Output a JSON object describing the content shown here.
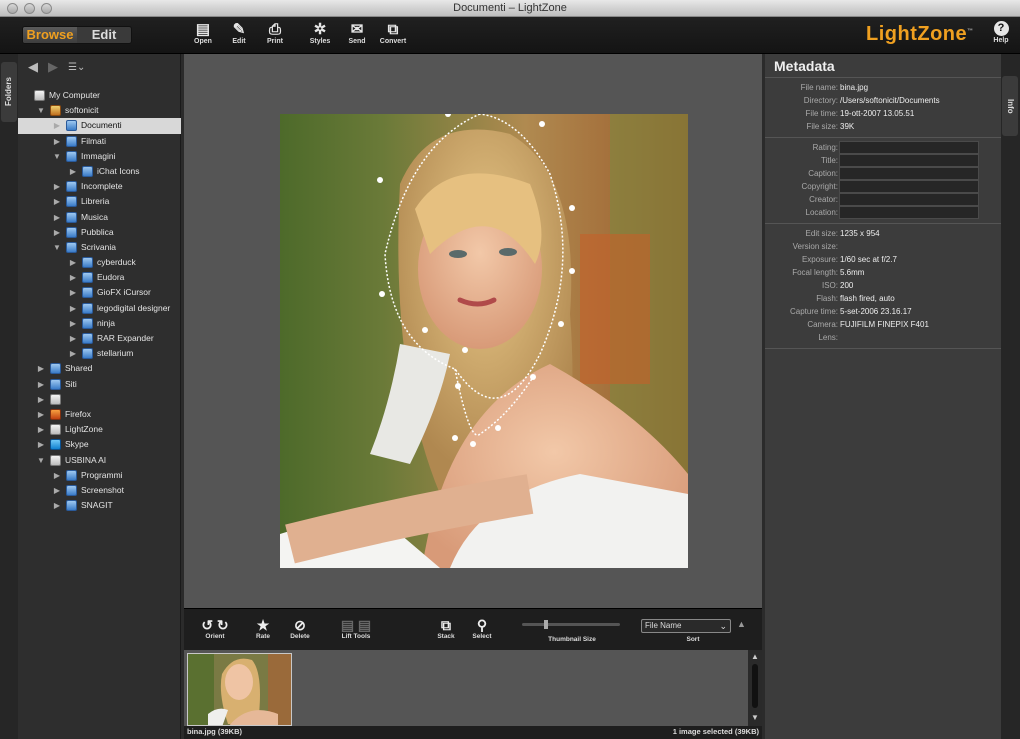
{
  "window": {
    "title": "Documenti – LightZone"
  },
  "modes": {
    "browse": "Browse",
    "edit": "Edit"
  },
  "toolbar": [
    {
      "label": "Open",
      "icon": "open-icon",
      "glyph": "▤"
    },
    {
      "label": "Edit",
      "icon": "edit-icon",
      "glyph": "✎"
    },
    {
      "label": "Print",
      "icon": "print-icon",
      "glyph": "⎙"
    },
    {
      "label": "Styles",
      "icon": "styles-icon",
      "glyph": "✲"
    },
    {
      "label": "Send",
      "icon": "send-icon",
      "glyph": "✉"
    },
    {
      "label": "Convert",
      "icon": "convert-icon",
      "glyph": "⧉"
    }
  ],
  "brand": "LightZone",
  "help": "Help",
  "side_tabs": {
    "left": "Folders",
    "right": "Info"
  },
  "folders": [
    {
      "label": "My Computer",
      "depth": 0,
      "arrow": "",
      "icon": "drive"
    },
    {
      "label": "softonicit",
      "depth": 1,
      "arrow": "▼",
      "icon": "home"
    },
    {
      "label": "Documenti",
      "depth": 2,
      "arrow": "▶",
      "icon": "folder",
      "selected": true
    },
    {
      "label": "Filmati",
      "depth": 2,
      "arrow": "▶",
      "icon": "folder"
    },
    {
      "label": "Immagini",
      "depth": 2,
      "arrow": "▼",
      "icon": "folder"
    },
    {
      "label": "iChat Icons",
      "depth": 3,
      "arrow": "▶",
      "icon": "folder"
    },
    {
      "label": "Incomplete",
      "depth": 2,
      "arrow": "▶",
      "icon": "folder"
    },
    {
      "label": "Libreria",
      "depth": 2,
      "arrow": "▶",
      "icon": "folder"
    },
    {
      "label": "Musica",
      "depth": 2,
      "arrow": "▶",
      "icon": "folder"
    },
    {
      "label": "Pubblica",
      "depth": 2,
      "arrow": "▶",
      "icon": "folder"
    },
    {
      "label": "Scrivania",
      "depth": 2,
      "arrow": "▼",
      "icon": "folder"
    },
    {
      "label": "cyberduck",
      "depth": 3,
      "arrow": "▶",
      "icon": "folder"
    },
    {
      "label": "Eudora",
      "depth": 3,
      "arrow": "▶",
      "icon": "folder"
    },
    {
      "label": "GioFX iCursor",
      "depth": 3,
      "arrow": "▶",
      "icon": "folder"
    },
    {
      "label": "legodigital designer",
      "depth": 3,
      "arrow": "▶",
      "icon": "folder"
    },
    {
      "label": "ninja",
      "depth": 3,
      "arrow": "▶",
      "icon": "folder"
    },
    {
      "label": "RAR Expander",
      "depth": 3,
      "arrow": "▶",
      "icon": "folder"
    },
    {
      "label": "stellarium",
      "depth": 3,
      "arrow": "▶",
      "icon": "folder"
    },
    {
      "label": "Shared",
      "depth": 1,
      "arrow": "▶",
      "icon": "folder"
    },
    {
      "label": "Siti",
      "depth": 1,
      "arrow": "▶",
      "icon": "folder"
    },
    {
      "label": "",
      "depth": 1,
      "arrow": "▶",
      "icon": "drive"
    },
    {
      "label": "Firefox",
      "depth": 1,
      "arrow": "▶",
      "icon": "app1"
    },
    {
      "label": "LightZone",
      "depth": 1,
      "arrow": "▶",
      "icon": "drive"
    },
    {
      "label": "Skype",
      "depth": 1,
      "arrow": "▶",
      "icon": "app2"
    },
    {
      "label": "USBINA AI",
      "depth": 1,
      "arrow": "▼",
      "icon": "drive"
    },
    {
      "label": "Programmi",
      "depth": 2,
      "arrow": "▶",
      "icon": "folder"
    },
    {
      "label": "Screenshot",
      "depth": 2,
      "arrow": "▶",
      "icon": "folder"
    },
    {
      "label": "SNAGIT",
      "depth": 2,
      "arrow": "▶",
      "icon": "folder"
    }
  ],
  "bottom_tools": {
    "orient": "Orient",
    "rate": "Rate",
    "delete": "Delete",
    "lift_tools": "Lift Tools",
    "stack": "Stack",
    "select": "Select",
    "thumbnail_size": "Thumbnail Size",
    "sort": "Sort",
    "sort_value": "File Name"
  },
  "status": {
    "left": "bina.jpg (39KB)",
    "right": "1 image selected (39KB)"
  },
  "metadata": {
    "title": "Metadata",
    "file": [
      {
        "k": "File name:",
        "v": "bina.jpg"
      },
      {
        "k": "Directory:",
        "v": "/Users/softonicit/Documents"
      },
      {
        "k": "File time:",
        "v": "19-ott-2007 13.05.51"
      },
      {
        "k": "File size:",
        "v": "39K"
      }
    ],
    "editable": [
      "Rating:",
      "Title:",
      "Caption:",
      "Copyright:",
      "Creator:",
      "Location:"
    ],
    "camera": [
      {
        "k": "Edit size:",
        "v": "1235 x 954"
      },
      {
        "k": "Version size:",
        "v": ""
      },
      {
        "k": "Exposure:",
        "v": "1/60 sec at f/2.7"
      },
      {
        "k": "Focal length:",
        "v": "5.6mm"
      },
      {
        "k": "ISO:",
        "v": "200"
      },
      {
        "k": "Flash:",
        "v": "flash fired, auto"
      },
      {
        "k": "Capture time:",
        "v": "5-set-2006 23.16.17"
      },
      {
        "k": "Camera:",
        "v": "FUJIFILM FINEPIX F401"
      },
      {
        "k": "Lens:",
        "v": ""
      }
    ]
  }
}
